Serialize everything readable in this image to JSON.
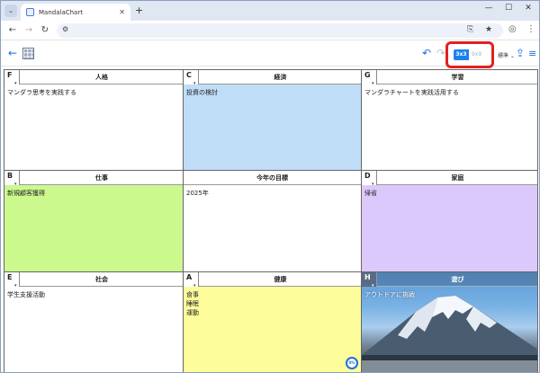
{
  "browser": {
    "tab_title": "MandalaChart",
    "tab_close": "✕",
    "new_tab": "+",
    "win_min": "—",
    "win_max": "☐",
    "win_close": "✕"
  },
  "app": {
    "view_3x3": "3x3",
    "view_9x9": "9x9",
    "mode_select": "標準 ⌄"
  },
  "cells": [
    {
      "id": "F",
      "letter": "F",
      "title": "人格",
      "body": "マンダラ思考を実践する",
      "color": "#ffffff"
    },
    {
      "id": "C",
      "letter": "C",
      "title": "経済",
      "body": "投資の検討",
      "color": "#bfddf7"
    },
    {
      "id": "G",
      "letter": "G",
      "title": "学習",
      "body": "マンダラチャートを実践活用する",
      "color": "#ffffff"
    },
    {
      "id": "B",
      "letter": "B",
      "title": "仕事",
      "body": "新規顧客獲得",
      "color": "#ccf98e"
    },
    {
      "id": "center",
      "letter": "",
      "title": "今年の目標",
      "body": "2025年",
      "color": "#ffffff"
    },
    {
      "id": "D",
      "letter": "D",
      "title": "家庭",
      "body": "帰省",
      "color": "#dcc9fb"
    },
    {
      "id": "E",
      "letter": "E",
      "title": "社会",
      "body": "学生支援活動",
      "color": "#ffffff"
    },
    {
      "id": "A",
      "letter": "A",
      "title": "健康",
      "body": "食事\n睡眠\n運動",
      "color": "#fdfd9c"
    },
    {
      "id": "H",
      "letter": "H",
      "title": "遊び",
      "body": "アウトドアに挑戦",
      "color": "#6a86a8"
    }
  ],
  "badge": "0%",
  "icons": {
    "tab_menu": "chevron-down-icon",
    "back": "arrow-left-icon",
    "forward": "arrow-right-icon",
    "reload": "reload-icon",
    "site_settings": "tune-icon",
    "install": "install-icon",
    "bookmark": "star-icon",
    "extensions": "extension-icon",
    "browser_menu": "kebab-icon",
    "app_back": "arrow-left-icon",
    "logo": "mandala-logo-icon",
    "undo": "undo-icon",
    "redo": "redo-icon",
    "share": "share-icon",
    "app_menu": "hamburger-icon"
  }
}
